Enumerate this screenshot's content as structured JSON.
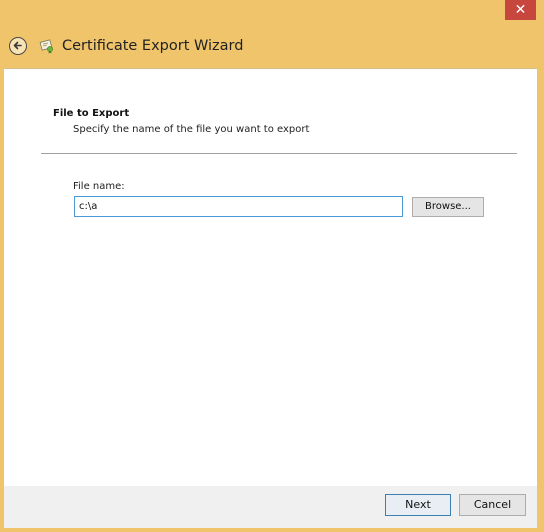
{
  "window": {
    "close_glyph": "✕",
    "title": "Certificate Export Wizard",
    "back_icon": "back-arrow-icon",
    "app_icon": "certificate-icon"
  },
  "page": {
    "heading": "File to Export",
    "description": "Specify the name of the file you want to export",
    "file_label": "File name:",
    "file_value": "c:\\a",
    "browse_label": "Browse..."
  },
  "footer": {
    "next_label": "Next",
    "cancel_label": "Cancel"
  },
  "colors": {
    "chrome": "#f0c46a",
    "close": "#c7463e",
    "input_focus": "#4a9ad8"
  }
}
